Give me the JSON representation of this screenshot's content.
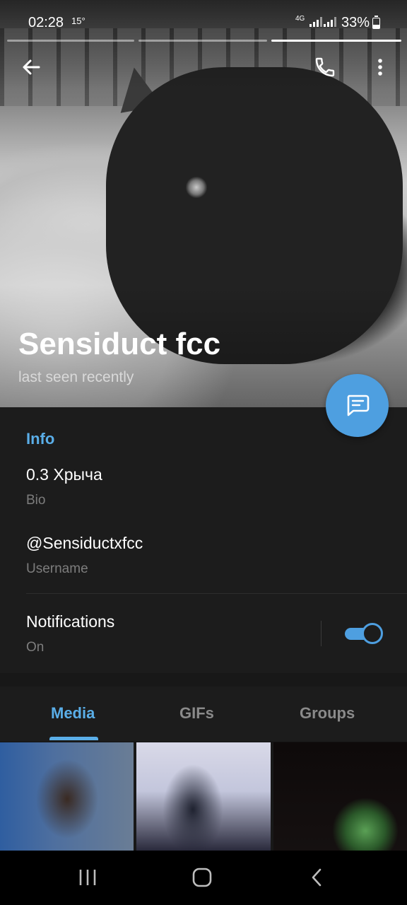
{
  "status_bar": {
    "time": "02:28",
    "temperature": "15°",
    "network": "4G",
    "battery": "33%"
  },
  "profile": {
    "name": "Sensiduct fcc",
    "last_seen": "last seen recently"
  },
  "info": {
    "header": "Info",
    "bio_value": "0.3 Хрыча",
    "bio_label": "Bio",
    "username_value": "@Sensiductxfcc",
    "username_label": "Username",
    "notifications_title": "Notifications",
    "notifications_state": "On"
  },
  "tabs": [
    {
      "label": "Media",
      "active": true
    },
    {
      "label": "GIFs",
      "active": false
    },
    {
      "label": "Groups",
      "active": false
    }
  ],
  "colors": {
    "accent": "#4e9fe0",
    "accent_text": "#5aaee8",
    "background": "#181818"
  },
  "icons": [
    "back-arrow-icon",
    "phone-icon",
    "more-vertical-icon",
    "message-icon",
    "recent-apps-icon",
    "home-icon",
    "back-nav-icon"
  ]
}
